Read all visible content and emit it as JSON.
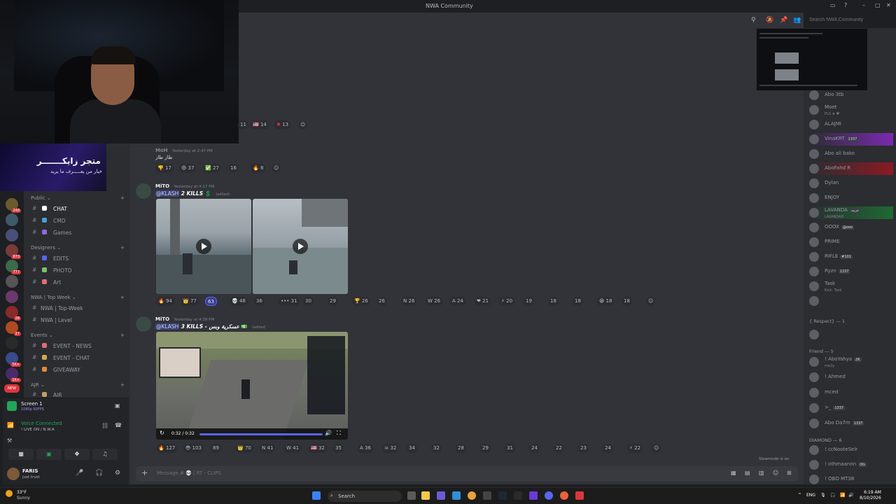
{
  "titlebar": {
    "title": "NWA Community"
  },
  "search": {
    "placeholder": "Search NWA Community"
  },
  "banner": {
    "title": "متجر زايكـــــــر",
    "subtitle": "خيار من يعـــــرف ما يريد"
  },
  "servers": [
    {
      "badge": "248"
    },
    {
      "badge": ""
    },
    {
      "badge": ""
    },
    {
      "badge": "873"
    },
    {
      "badge": "777"
    },
    {
      "badge": ""
    },
    {
      "badge": ""
    },
    {
      "badge": "28"
    },
    {
      "badge": "27"
    },
    {
      "badge": ""
    },
    {
      "badge": "5K+"
    },
    {
      "badge": "1K+"
    },
    {
      "badge": "NEW"
    }
  ],
  "categories": [
    {
      "label": "Public ⌄"
    },
    {
      "label": "Designers ⌄"
    },
    {
      "label": "NWA | Top Week ⌄"
    },
    {
      "label": "Events ⌄"
    },
    {
      "label": "AJR ⌄"
    }
  ],
  "channels": [
    {
      "label": "CHAT",
      "color": "#ffffff"
    },
    {
      "label": "CMD",
      "color": "#4b9cd3"
    },
    {
      "label": "Games",
      "color": "#8c6ad8"
    },
    {
      "label": "EDITS",
      "color": "#5865f2"
    },
    {
      "label": "PHOTO",
      "color": "#7cc06a"
    },
    {
      "label": "Art",
      "color": "#e06c75"
    },
    {
      "label": "NWA | Top-Week",
      "color": ""
    },
    {
      "label": "NWA | Level",
      "color": ""
    },
    {
      "label": "EVENT - NEWS",
      "color": "#e06c75"
    },
    {
      "label": "EVENT - CHAT",
      "color": "#d4a94c"
    },
    {
      "label": "GIVEAWAY",
      "color": "#e38a3c"
    },
    {
      "label": "AIR",
      "color": "#c0a060"
    }
  ],
  "screen_share": {
    "title": "Screen 1",
    "quality": "1080p 60FPS"
  },
  "voice": {
    "status": "Voice Connected",
    "channel": "! LIVE ON / N.W.A"
  },
  "user": {
    "name": "FARIS",
    "status": "just trust"
  },
  "messages": {
    "top_reactions": [
      {
        "e": "",
        "n": "11"
      },
      {
        "e": "🇺🇸",
        "n": "14"
      },
      {
        "e": "✖",
        "n": "13"
      },
      {
        "e": "☺",
        "n": ""
      }
    ],
    "m1": {
      "author": "MoH",
      "time": "Yesterday at 2:47 PM",
      "text": "طاز طاز",
      "reactions": [
        {
          "e": "👎",
          "n": "17"
        },
        {
          "e": "😄",
          "n": "37"
        },
        {
          "e": "✅",
          "n": "27"
        },
        {
          "e": "",
          "n": "16"
        },
        {
          "e": "🔥",
          "n": "8"
        },
        {
          "e": "☺",
          "n": ""
        }
      ]
    },
    "m2": {
      "author": "MiTO",
      "time": "Yesterday at 4:17 PM",
      "mention": "@KLASH",
      "kills": "2 KILLS",
      "edited": "(edited)",
      "reactions": [
        {
          "e": "🔥",
          "n": "94"
        },
        {
          "e": "👑",
          "n": "77"
        },
        {
          "e": "",
          "n": "63"
        },
        {
          "e": "💀",
          "n": "48"
        },
        {
          "e": "",
          "n": "36"
        },
        {
          "e": "•••",
          "n": "31"
        },
        {
          "e": "",
          "n": "30"
        },
        {
          "e": "",
          "n": "29"
        },
        {
          "e": "🏆",
          "n": "26"
        },
        {
          "e": "",
          "n": "26"
        },
        {
          "e": "N",
          "n": "26"
        },
        {
          "e": "W",
          "n": "26"
        },
        {
          "e": "A",
          "n": "24"
        },
        {
          "e": "❤",
          "n": "21"
        },
        {
          "e": "⚡",
          "n": "20"
        },
        {
          "e": "",
          "n": "19"
        },
        {
          "e": "",
          "n": "18"
        },
        {
          "e": "",
          "n": "18"
        },
        {
          "e": "😁",
          "n": "18"
        },
        {
          "e": "",
          "n": "18"
        },
        {
          "e": "☺",
          "n": ""
        }
      ]
    },
    "m3": {
      "author": "MiTO",
      "time": "Yesterday at 4:39 PM",
      "mention": "@KLASH",
      "kills": "3 KILLS - عسكرية وبس",
      "edited": "(edited)",
      "video_time": "0:32 / 0:32",
      "reactions": [
        {
          "e": "🔥",
          "n": "127"
        },
        {
          "e": "😎",
          "n": "103"
        },
        {
          "e": "",
          "n": "89"
        },
        {
          "e": "👑",
          "n": "70"
        },
        {
          "e": "N",
          "n": "41"
        },
        {
          "e": "W",
          "n": "41"
        },
        {
          "e": "🇺🇸",
          "n": "32"
        },
        {
          "e": "",
          "n": "35"
        },
        {
          "e": "A",
          "n": "36"
        },
        {
          "e": "☠",
          "n": "32"
        },
        {
          "e": "",
          "n": "34"
        },
        {
          "e": "",
          "n": "32"
        },
        {
          "e": "",
          "n": "28"
        },
        {
          "e": "",
          "n": "29"
        },
        {
          "e": "",
          "n": "31"
        },
        {
          "e": "",
          "n": "24"
        },
        {
          "e": "",
          "n": "22"
        },
        {
          "e": "",
          "n": "23"
        },
        {
          "e": "",
          "n": "24"
        },
        {
          "e": "⚡",
          "n": "22"
        },
        {
          "e": "☺",
          "n": ""
        }
      ]
    }
  },
  "slowmode": "Slowmode is on",
  "composer": {
    "placeholder": "Message # 💀 | RT - CLIPS"
  },
  "members": [
    {
      "name": "Abo 3tb",
      "tag": "",
      "sub": ""
    },
    {
      "name": "Moet",
      "tag": "",
      "sub": "PLS ★ ♥"
    },
    {
      "name": "ALAJMI",
      "tag": "",
      "sub": ""
    },
    {
      "name": "VinaKRT",
      "tag": "1337",
      "sub": ""
    },
    {
      "name": "Abo ali bako",
      "tag": "",
      "sub": ""
    },
    {
      "name": "AboFahd R",
      "tag": "",
      "sub": ""
    },
    {
      "name": "Dylan",
      "tag": "",
      "sub": ""
    },
    {
      "name": "ENJOY",
      "tag": "",
      "sub": ""
    },
    {
      "name": "LAVANDA",
      "tag": "عربيه",
      "sub": "LAVANDAD"
    },
    {
      "name": "OOOX",
      "tag": "@ooo",
      "sub": ""
    },
    {
      "name": "PRIME",
      "tag": "",
      "sub": ""
    },
    {
      "name": "RIFLE",
      "tag": "#101",
      "sub": ""
    },
    {
      "name": "Ryzn",
      "tag": "1337",
      "sub": ""
    },
    {
      "name": "Task",
      "tag": "",
      "sub": "Kick: Task"
    },
    {
      "name": "",
      "tag": "",
      "sub": ""
    }
  ],
  "groups": {
    "respect": "{ Respect} — 1",
    "friend": "Friend — 5",
    "diamond": "DIAMOND — 6"
  },
  "friend_members": [
    {
      "name": "! AboYahya",
      "tag": "2K",
      "sub": "me2y"
    },
    {
      "name": "! Ahmed",
      "tag": "",
      "sub": ""
    },
    {
      "name": "mced",
      "tag": "",
      "sub": ""
    },
    {
      "name": ">_",
      "tag": "1337",
      "sub": ""
    },
    {
      "name": "Abo Da7m",
      "tag": "1337",
      "sub": ""
    }
  ],
  "diamond_members": [
    {
      "name": "! ccNooteSelr",
      "tag": "",
      "sub": ""
    },
    {
      "name": "! othmaannn",
      "tag": "OG",
      "sub": ""
    },
    {
      "name": "! ОВО МТЗ8",
      "tag": "",
      "sub": ""
    }
  ],
  "taskbar": {
    "temp": "33°F",
    "weather": "Sunny",
    "search": "Search",
    "lang": "ENG",
    "time": "6:19 AM",
    "date": "8/10/2026"
  },
  "colors": {
    "accent": "#5865f2",
    "bg": "#313338",
    "sidebar": "#2b2d31"
  }
}
